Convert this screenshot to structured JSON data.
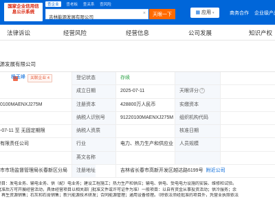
{
  "header": {
    "logo_text": "国家企业信用信息公示系统",
    "tabs": [
      "查企业",
      "查老板",
      "查关系",
      "查风险"
    ],
    "active_tab": 0,
    "search_value": "吉林能源发展有限公司",
    "clear_icon": "close-icon",
    "search_button": "天眼一下",
    "apps_label": "应用",
    "business_link": "商务合作",
    "enterprise_link": "企业级产品"
  },
  "nav": [
    "法律诉讼",
    "经营风险",
    "经营信息",
    "公司发展",
    "知识产权"
  ],
  "company": {
    "name": "能源发展有限公司",
    "legal_rep_name": "杨玉峰",
    "legal_rep_badge": "关联企业 4",
    "rows": [
      {
        "left": "",
        "label1": "登记状态",
        "val1": "存续",
        "label2": "",
        "val2": ""
      },
      {
        "left": "",
        "label1": "成立日期",
        "val1": "2025-07-11",
        "label2": "天眼评分",
        "val2": ""
      },
      {
        "left": "0100MAENXJ275M",
        "label1": "注册资本",
        "val1": "428800万人民币",
        "label2": "实缴资本",
        "val2": ""
      },
      {
        "left": "",
        "label1": "纳税人识别号",
        "val1": "91220100MAENXJ275M",
        "label2": "组织机构代码",
        "val2": ""
      },
      {
        "left": "-07-11 至 无固定期限",
        "label1": "纳税人资质",
        "val1": "",
        "label2": "核准日期",
        "val2": ""
      },
      {
        "left": "有限责任公司",
        "label1": "行业",
        "val1": "电力、热力生产和供应业",
        "label2": "人员规模",
        "val2": ""
      },
      {
        "left": "",
        "label1": "英文名称",
        "val1": "",
        "label2": "",
        "val2": ""
      }
    ],
    "address": {
      "left": "市市场监督管理局长春新区分局",
      "label": "注册地址",
      "value": "吉林省长春市高新开发区越达路6199号",
      "link": "附近公司"
    },
    "scope_lines": [
      "项目：发电业务、输电业务、供（配）电业务；建设工程施工；热力生产和供应；输电、供电、受电电力设施的安装、维修和试验。",
      "批准后方可开展经营活动，具体经营项目以相关部门批准文件或许可证件为准）一般项目：以自有资金从事投资活动；供冷服务；余",
      "；再生资源销售；石灰和石膏销售；新兴能源技术研发；合同能源管理；通用设备修理。（除依法须经批准的项目外，凭营业执照依法"
    ]
  },
  "colors": {
    "brand_blue": "#0066d9",
    "search_orange": "#ff6a00",
    "status_green": "#2ba245"
  }
}
